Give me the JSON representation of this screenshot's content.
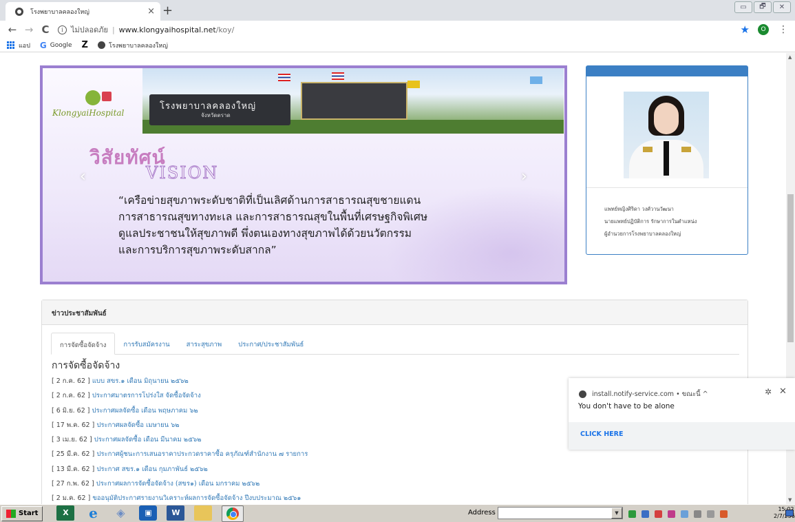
{
  "browser": {
    "tab_title": "โรงพยาบาลคลองใหญ่",
    "tab_close": "×",
    "new_tab": "+",
    "window_buttons": [
      "▭",
      "🗗",
      "✕"
    ],
    "nav": {
      "back": "←",
      "forward": "→",
      "reload": "C"
    },
    "url": {
      "insecure_label": "ไม่ปลอดภัย",
      "host": "www.klongyaihospital.net",
      "path": "/koy/"
    },
    "star": "★",
    "profile_letter": "O",
    "menu": "⋮",
    "bookmarks": [
      {
        "label": "แอป",
        "icon": "apps-grid-icon"
      },
      {
        "label": "Google",
        "icon": "google-icon"
      },
      {
        "label": "",
        "icon": "z-icon"
      },
      {
        "label": "โรงพยาบาลคลองใหญ่",
        "icon": "globe-icon"
      }
    ]
  },
  "slider": {
    "logo_text": "KlongyaiHospital",
    "gate_sign": "โรงพยาบาลคลองใหญ่",
    "gate_sub": "จังหวัดตราด",
    "vision_th": "วิสัยทัศน์",
    "vision_en": "VISION",
    "vision_lines": [
      "“เครือข่ายสุขภาพระดับชาติที่เป็นเลิศด้านการสาธารณสุขชายแดน",
      "การสาธารณสุขทางทะเล และการสาธารณสุขในพื้นที่เศรษฐกิจพิเศษ",
      "ดูแลประชาชนให้สุขภาพดี พึ่งตนเองทางสุขภาพได้ด้วยนวัตกรรม",
      "และการบริการสุขภาพระดับสากล”"
    ],
    "prev": "‹",
    "next": "›"
  },
  "director": {
    "lines": [
      "แพทย์หญิงศิริดา วงศ์วานวัฒนา",
      "นายแพทย์ปฏิบัติการ รักษาการในตำแหน่ง",
      "ผู้อำนวยการโรงพยาบาลคลองใหญ่"
    ]
  },
  "news": {
    "heading": "ข่าวประชาสัมพันธ์",
    "tabs": [
      "การจัดซื้อจัดจ้าง",
      "การรับสมัครงาน",
      "สาระสุขภาพ",
      "ประกาศ/ประชาสัมพันธ์"
    ],
    "section_title": "การจัดซื้อจัดจ้าง",
    "items": [
      {
        "date": "[ 2 ก.ค. 62 ]",
        "title": "แบบ สขร.๑ เดือน มิถุนายน ๒๕๖๒"
      },
      {
        "date": "[ 2 ก.ค. 62 ]",
        "title": "ประกาศมาตรการโปร่งใส จัดซื้อจัดจ้าง"
      },
      {
        "date": "[ 6 มิ.ย. 62 ]",
        "title": "ประกาศผลจัดซื้อ เดือน พฤษภาคม ๖๒"
      },
      {
        "date": "[ 17 พ.ค. 62 ]",
        "title": "ประกาศผลจัดซื้อ เมษายน ๖๒"
      },
      {
        "date": "[ 3 เม.ย. 62 ]",
        "title": "ประกาศผลจัดซื้อ เดือน มีนาคม ๒๕๖๒"
      },
      {
        "date": "[ 25 มี.ค. 62 ]",
        "title": "ประกาศผู้ชนะการเสนอราคาประกวดราคาซื้อ ครุภัณฑ์สำนักงาน ๗ รายการ"
      },
      {
        "date": "[ 13 มี.ค. 62 ]",
        "title": "ประกาศ สขร.๑ เดือน กุมภาพันธ์ ๒๕๖๒"
      },
      {
        "date": "[ 27 ก.พ. 62 ]",
        "title": "ประกาศผลการจัดซื้อจัดจ้าง (สขร๑) เดือน มกราคม ๒๕๖๒"
      },
      {
        "date": "[ 2 ม.ค. 62 ]",
        "title": "ขออนุมัติประกาศรายงานวิเคราะห์ผลการจัดซื้อจัดจ้าง ปีงบประมาณ ๒๕๖๑"
      }
    ]
  },
  "notification": {
    "source": "install.notify-service.com • ขณะนี้ ^",
    "message": "You don't have to be alone",
    "cta": "CLICK HERE",
    "settings": "✲",
    "close": "✕"
  },
  "taskbar": {
    "start": "Start",
    "address_label": "Address",
    "time": "15:02",
    "date": "2/7/2562",
    "apps": [
      "excel-icon",
      "internet-explorer-icon",
      "remote-desktop-icon",
      "media-player-icon",
      "word-icon",
      "file-explorer-icon",
      "chrome-icon"
    ]
  },
  "colors": {
    "accent": "#337ab7",
    "slider_border": "#9b7fd0",
    "card_header": "#3b7fc4"
  }
}
